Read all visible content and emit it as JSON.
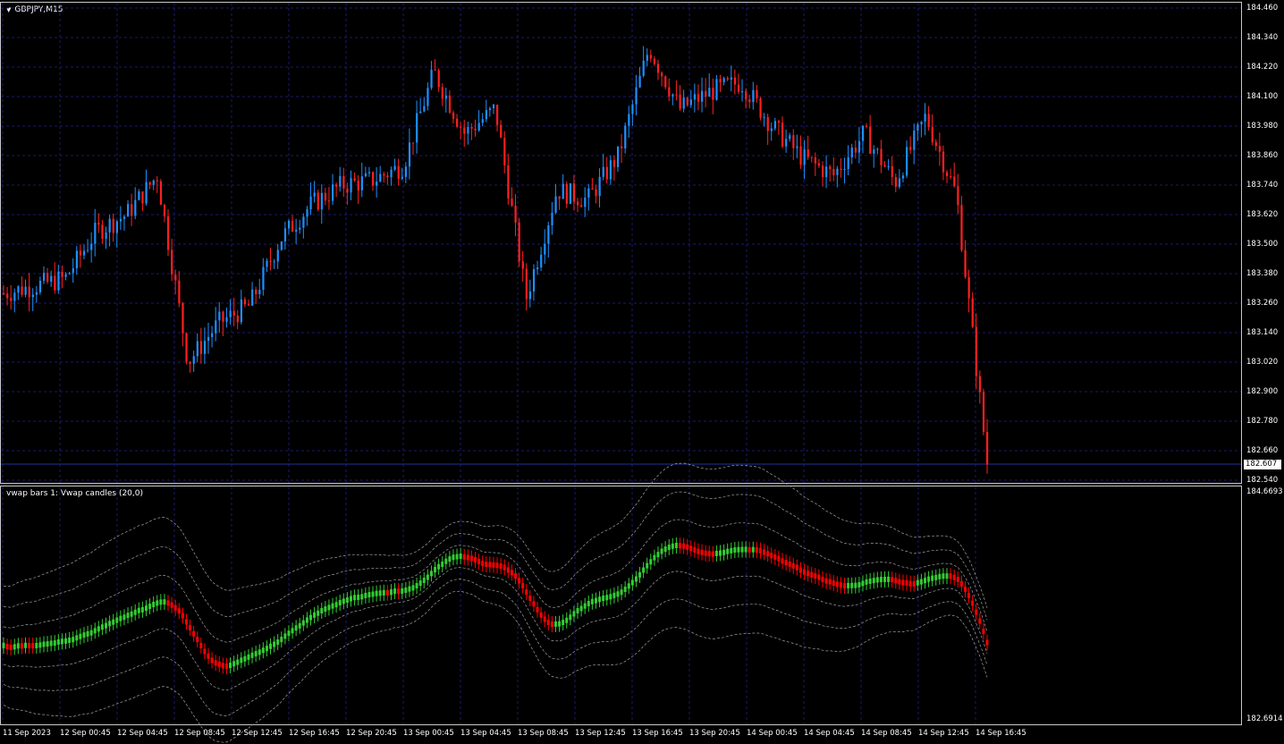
{
  "main_chart": {
    "title": "GBPJPY,M15",
    "price_scale": [
      "184.460",
      "184.340",
      "184.220",
      "184.100",
      "183.980",
      "183.860",
      "183.740",
      "183.620",
      "183.500",
      "183.380",
      "183.260",
      "183.140",
      "183.020",
      "182.900",
      "182.780",
      "182.660",
      "182.540"
    ],
    "current_price": "182.607"
  },
  "indicator_chart": {
    "title": "vwap bars 1: Vwap candles (20,0)",
    "scale_top": "184.6693",
    "scale_bottom": "182.6914"
  },
  "time_axis": [
    "11 Sep 2023",
    "12 Sep 00:45",
    "12 Sep 04:45",
    "12 Sep 08:45",
    "12 Sep 12:45",
    "12 Sep 16:45",
    "12 Sep 20:45",
    "13 Sep 00:45",
    "13 Sep 04:45",
    "13 Sep 08:45",
    "13 Sep 12:45",
    "13 Sep 16:45",
    "13 Sep 20:45",
    "14 Sep 00:45",
    "14 Sep 04:45",
    "14 Sep 08:45",
    "14 Sep 12:45",
    "14 Sep 16:45"
  ],
  "colors": {
    "background": "#000000",
    "grid": "#1a1a6e",
    "bull": "#1e90ff",
    "bear": "#ff2020",
    "vwap_up": "#32cd32",
    "vwap_down": "#ff0000",
    "bands": "#a0a0a0"
  },
  "chart_data": [
    {
      "type": "candlestick",
      "title": "GBPJPY,M15",
      "ylim": [
        182.54,
        184.46
      ],
      "x": [
        "11 Sep 2023",
        "12 Sep 00:45",
        "12 Sep 04:45",
        "12 Sep 08:45",
        "12 Sep 12:45",
        "12 Sep 16:45",
        "12 Sep 20:45",
        "13 Sep 00:45",
        "13 Sep 04:45",
        "13 Sep 08:45",
        "13 Sep 12:45",
        "13 Sep 16:45",
        "13 Sep 20:45",
        "14 Sep 00:45",
        "14 Sep 04:45",
        "14 Sep 08:45",
        "14 Sep 12:45",
        "14 Sep 16:45"
      ],
      "close_path": [
        183.3,
        183.33,
        183.36,
        183.55,
        183.62,
        183.78,
        183.02,
        183.18,
        183.25,
        183.52,
        183.66,
        183.74,
        183.76,
        183.82,
        184.2,
        183.95,
        184.05,
        183.28,
        183.72,
        183.68,
        183.86,
        184.3,
        184.05,
        184.12,
        184.16,
        183.98,
        183.85,
        183.78,
        183.95,
        183.75,
        184.02,
        183.7,
        182.61
      ]
    },
    {
      "type": "line",
      "title": "vwap bars 1: Vwap candles (20,0)",
      "ylim": [
        182.6914,
        184.6693
      ]
    }
  ]
}
